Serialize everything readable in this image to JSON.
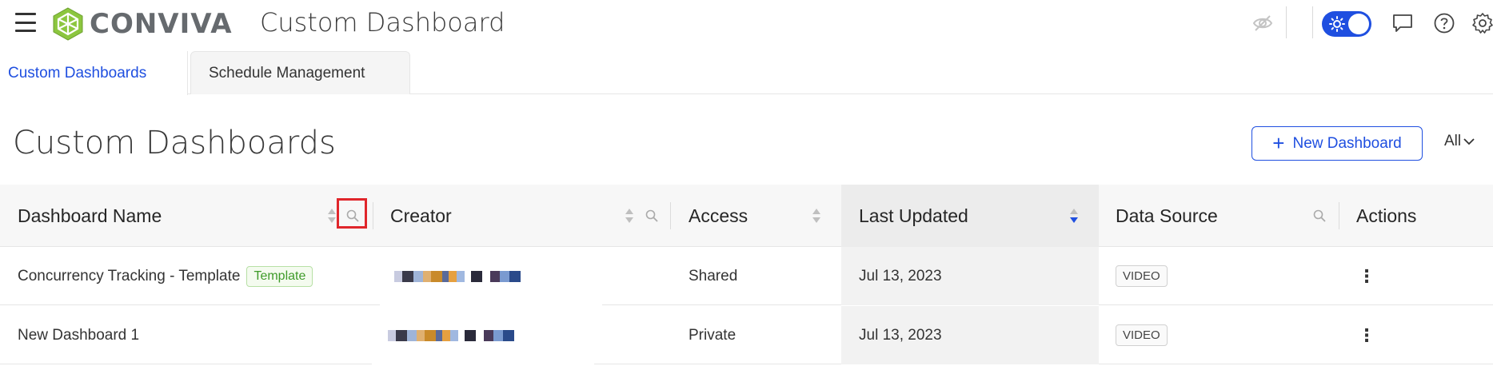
{
  "header": {
    "logo_text": "CONVIVA",
    "app_title": "Custom Dashboard"
  },
  "tabs": [
    {
      "label": "Custom Dashboards",
      "active": true
    },
    {
      "label": "Schedule Management",
      "active": false
    }
  ],
  "page": {
    "title": "Custom Dashboards",
    "new_button_label": "New Dashboard",
    "filter_label": "All"
  },
  "table": {
    "columns": [
      "Dashboard Name",
      "Creator",
      "Access",
      "Last Updated",
      "Data Source",
      "Actions"
    ],
    "sorted_column": "Last Updated",
    "rows": [
      {
        "name": "Concurrency Tracking - Template",
        "tag": "Template",
        "access": "Shared",
        "last_updated": "Jul 13, 2023",
        "data_source": "VIDEO"
      },
      {
        "name": "New Dashboard 1",
        "tag": "",
        "access": "Private",
        "last_updated": "Jul 13, 2023",
        "data_source": "VIDEO"
      }
    ]
  },
  "colors": {
    "accent": "#1f4fe0",
    "highlight": "#e0262b",
    "template_tag": "#3f9b2a"
  }
}
